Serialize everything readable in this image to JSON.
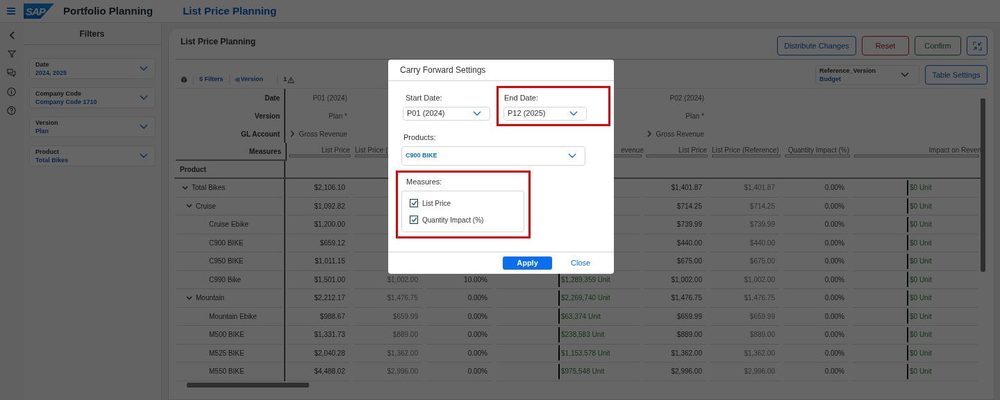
{
  "app_header": {
    "logo": "SAP",
    "app_title": "Portfolio Planning",
    "page_title": "List Price Planning"
  },
  "filters": {
    "title": "Filters",
    "items": [
      {
        "label": "Date",
        "value": "2024, 2025"
      },
      {
        "label": "Company Code",
        "value": "Company Code 1710"
      },
      {
        "label": "Version",
        "value": "Plan"
      },
      {
        "label": "Product",
        "value": "Total Bikes"
      }
    ]
  },
  "main": {
    "title": "List Price Planning",
    "buttons": [
      {
        "label": "Distribute Changes",
        "kind": "default"
      },
      {
        "label": "Reset",
        "kind": "reject"
      },
      {
        "label": "Confirm",
        "kind": "accept"
      }
    ],
    "reference_select": {
      "label": "Reference_Version",
      "value": "Budget"
    },
    "table_settings": "Table Settings",
    "toolbar": {
      "filters": "5 Filters",
      "version": "Version",
      "warnings": "1"
    }
  },
  "table": {
    "header_labels": [
      "Date",
      "Version",
      "GL Account",
      "Measures"
    ],
    "row_header": "Product",
    "groups": [
      {
        "date": "P01 (2024)",
        "version": "Plan *",
        "gl_account": "Gross Revenue",
        "measures": {
          "list_price": "List Price",
          "reference": "List Price (",
          "impact": "evenue"
        }
      },
      {
        "date": "P02 (2024)",
        "version": "Plan *",
        "gl_account": "Gross Revenue",
        "measures": {
          "list_price": "List Price",
          "reference": "List Price (Reference)",
          "quantity_impact": "Quantity Impact (%)",
          "impact": "Impact on Reven"
        }
      }
    ],
    "rows": [
      {
        "product": "Total Bikes",
        "expanded": true,
        "values": [
          {
            "list_price": "$2,106.10"
          },
          {
            "list_price": "$1,401.87",
            "reference": "$1,401.87",
            "quantity_impact": "0.00%",
            "impact": "$0 Unit"
          }
        ],
        "children": [
          {
            "product": "Cruise",
            "expanded": true,
            "values": [
              {
                "list_price": "$1,092.82"
              },
              {
                "list_price": "$714.25",
                "reference": "$714.25",
                "quantity_impact": "0.00%",
                "impact": "$0 Unit"
              }
            ],
            "children": [
              {
                "product": "Cruise Ebike",
                "values": [
                  {
                    "list_price": "$1,200.00"
                  },
                  {
                    "list_price": "$739.99",
                    "reference": "$739.99",
                    "quantity_impact": "0.00%",
                    "impact": "$0 Unit"
                  }
                ]
              },
              {
                "product": "C900 BIKE",
                "values": [
                  {
                    "list_price": "$659.12"
                  },
                  {
                    "list_price": "$440.00",
                    "reference": "$440.00",
                    "quantity_impact": "0.00%",
                    "impact": "$0 Unit"
                  }
                ]
              },
              {
                "product": "C950 BIKE",
                "values": [
                  {
                    "list_price": "$1,011.15"
                  },
                  {
                    "list_price": "$675.00",
                    "reference": "$675.00",
                    "quantity_impact": "0.00%",
                    "impact": "$0 Unit"
                  }
                ]
              },
              {
                "product": "C990 Bike",
                "values": [
                  {
                    "list_price": "$1,501.00",
                    "reference": "$1,002.00",
                    "quantity_impact": "10.00%",
                    "impact": "$1,289,359 Unit"
                  },
                  {
                    "list_price": "$1,002.00",
                    "reference": "$1,002.00",
                    "quantity_impact": "0.00%",
                    "impact": "$0 Unit"
                  }
                ]
              }
            ]
          },
          {
            "product": "Mountain",
            "expanded": true,
            "values": [
              {
                "list_price": "$2,212.17",
                "reference": "$1,476.75",
                "quantity_impact": "0.00%",
                "impact": "$2,269,740 Unit"
              },
              {
                "list_price": "$1,476.75",
                "reference": "$1,476.75",
                "quantity_impact": "0.00%",
                "impact": "$0 Unit"
              }
            ],
            "children": [
              {
                "product": "Mountain Ebike",
                "values": [
                  {
                    "list_price": "$988.67",
                    "reference": "$659.99",
                    "quantity_impact": "0.00%",
                    "impact": "$63,374 Unit"
                  },
                  {
                    "list_price": "$659.99",
                    "reference": "$659.99",
                    "quantity_impact": "0.00%",
                    "impact": "$0 Unit"
                  }
                ]
              },
              {
                "product": "M500 BIKE",
                "values": [
                  {
                    "list_price": "$1,331.73",
                    "reference": "$889.00",
                    "quantity_impact": "0.00%",
                    "impact": "$238,583 Unit"
                  },
                  {
                    "list_price": "$889.00",
                    "reference": "$889.00",
                    "quantity_impact": "0.00%",
                    "impact": "$0 Unit"
                  }
                ]
              },
              {
                "product": "M525 BIKE",
                "values": [
                  {
                    "list_price": "$2,040.28",
                    "reference": "$1,362.00",
                    "quantity_impact": "0.00%",
                    "impact": "$1,153,578 Unit"
                  },
                  {
                    "list_price": "$1,362.00",
                    "reference": "$1,362.00",
                    "quantity_impact": "0.00%",
                    "impact": "$0 Unit"
                  }
                ]
              },
              {
                "product": "M550 BIKE",
                "values": [
                  {
                    "list_price": "$4,488.02",
                    "reference": "$2,996.00",
                    "quantity_impact": "0.00%",
                    "impact": "$975,548 Unit"
                  },
                  {
                    "list_price": "$2,996.00",
                    "reference": "$2,996.00",
                    "quantity_impact": "0.00%",
                    "impact": "$0 Unit"
                  }
                ]
              }
            ]
          }
        ]
      }
    ]
  },
  "dialog": {
    "title": "Carry Forward Settings",
    "start_date": {
      "label": "Start Date:",
      "value": "P01 (2024)"
    },
    "end_date": {
      "label": "End Date:",
      "value": "P12 (2025)",
      "highlighted": true
    },
    "products": {
      "label": "Products:",
      "value": "C900 BIKE"
    },
    "measures": {
      "label": "Measures:",
      "highlighted": true,
      "options": [
        {
          "label": "List Price",
          "checked": true
        },
        {
          "label": "Quantity Impact (%)",
          "checked": true
        }
      ]
    },
    "buttons": [
      {
        "label": "Apply",
        "kind": "emphasized"
      },
      {
        "label": "Close",
        "kind": "transparent"
      }
    ]
  }
}
